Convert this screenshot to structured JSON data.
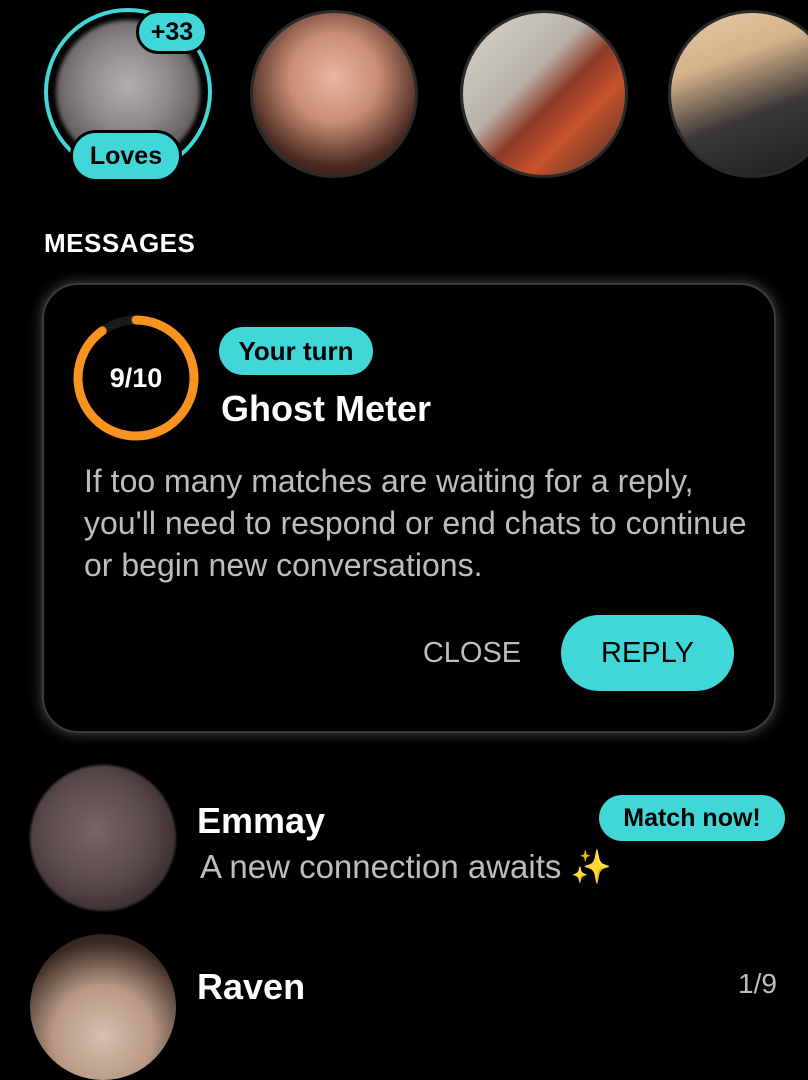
{
  "top_row": {
    "loves_badge_count": "+33",
    "loves_label": "Loves",
    "avatars": [
      {
        "name": "profile-photo-1"
      },
      {
        "name": "profile-photo-2"
      },
      {
        "name": "profile-photo-3"
      }
    ]
  },
  "messages": {
    "section_label": "MESSAGES",
    "ghost_meter_card": {
      "meter_value": "9/10",
      "meter_fraction": 0.9,
      "turn_badge": "Your turn",
      "title": "Ghost Meter",
      "body": "If too many matches are waiting for a reply, you'll need to respond or end chats to continue or begin new conversations.",
      "close_label": "CLOSE",
      "reply_label": "REPLY"
    },
    "conversations": [
      {
        "name": "Emmay",
        "preview": "A new connection awaits ✨",
        "action_label": "Match now!"
      },
      {
        "name": "Raven",
        "count": "1/9"
      }
    ]
  },
  "colors": {
    "accent": "#41d7d8",
    "meter": "#f7931e",
    "background": "#000000",
    "secondary_text": "#bdbdbd"
  }
}
